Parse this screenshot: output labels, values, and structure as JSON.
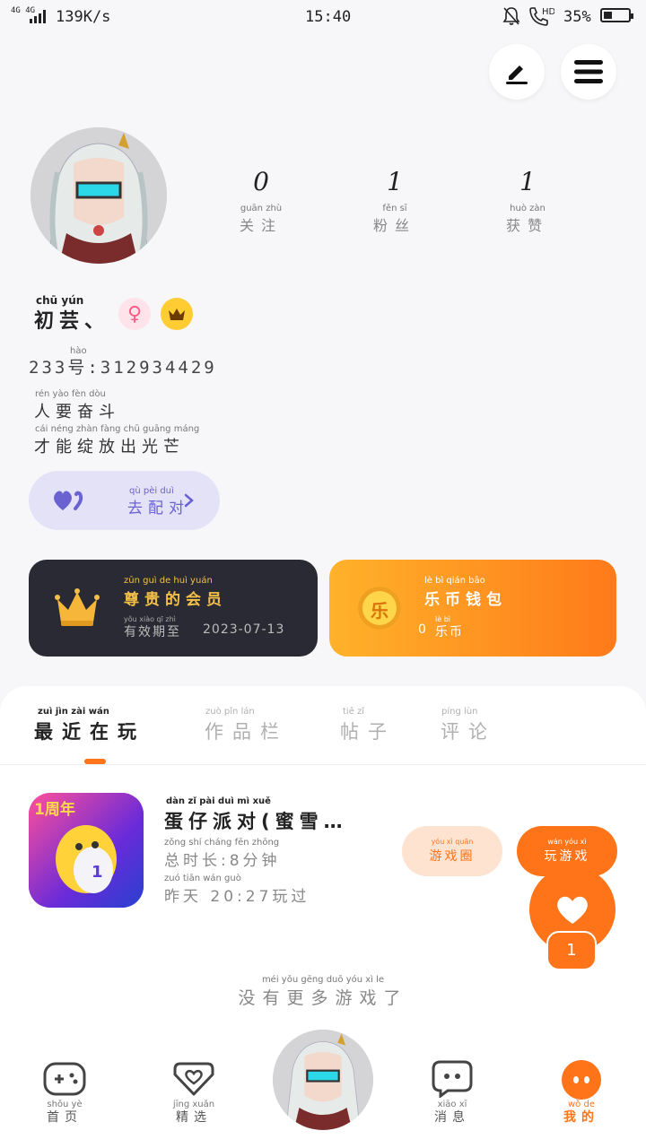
{
  "status_bar": {
    "network": "4G 4G",
    "speed": "139K/s",
    "time": "15:40",
    "hd": "HD",
    "battery": "35%",
    "battery_level": 0.35
  },
  "profile": {
    "stats": [
      {
        "value": "0",
        "pinyin": "guān  zhù",
        "label": "关注"
      },
      {
        "value": "1",
        "pinyin": "fěn   sī",
        "label": "粉丝"
      },
      {
        "value": "1",
        "pinyin": "huò  zàn",
        "label": "获赞"
      }
    ],
    "name_pinyin": "chū  yún",
    "name": "初芸、",
    "id_pinyin": "hào",
    "id": "233号:312934429",
    "bio_line1_pinyin": "rén  yào  fèn  dòu",
    "bio_line1": "人要奋斗",
    "bio_line2_pinyin": "cái néng zhàn fàng chū guāng máng",
    "bio_line2": "才能绽放出光芒",
    "pair_pinyin": "qù  pèi  duì",
    "pair_label": "去配对"
  },
  "cards": {
    "vip_pinyin": "zūn  guì  de  huì  yuán",
    "vip_title": "尊贵的会员",
    "vip_sub_pinyin": "yǒu xiào qī zhì",
    "vip_sub_label": "有效期至",
    "vip_date": "2023-07-13",
    "wallet_pinyin": "lè   bì  qián  bāo",
    "wallet_title": "乐币钱包",
    "wallet_icon": "乐",
    "wallet_sub_pinyin": "lè  bì",
    "wallet_amount": "0",
    "wallet_unit": "乐币"
  },
  "tabs": [
    {
      "pinyin": "zuì  jìn  zài  wán",
      "label": "最近在玩"
    },
    {
      "pinyin": "zuò  pǐn  lán",
      "label": "作品栏"
    },
    {
      "pinyin": "tiě  zǐ",
      "label": "帖子"
    },
    {
      "pinyin": "píng  lùn",
      "label": "评论"
    }
  ],
  "game": {
    "badge": "1周年",
    "title_pinyin": "dàn  zǐ  pài  duì  mì  xuě",
    "title": "蛋仔派对(蜜雪…",
    "duration_pinyin": "zǒng  shí  cháng      fēn zhōng",
    "duration": "总时长:8分钟",
    "last_played_pinyin": "zuó  tiān         wán guò",
    "last_played": "昨天 20:27玩过",
    "circle_pinyin": "yóu  xì  quān",
    "circle_label": "游戏圈",
    "play_pinyin": "wán  yóu  xì",
    "play_label": "玩游戏",
    "like_count": "1"
  },
  "no_more_pinyin": "méi  yǒu  gēng  duō  yóu  xì   le",
  "no_more": "没有更多游戏了",
  "nav": [
    {
      "pinyin": "shǒu  yè",
      "label": "首页",
      "icon": "gamepad-icon"
    },
    {
      "pinyin": "jīng  xuǎn",
      "label": "精选",
      "icon": "heart-bag-icon"
    },
    {
      "pinyin": "xiāo  xī",
      "label": "消息",
      "icon": "chat-icon"
    },
    {
      "pinyin": "wǒ   de",
      "label": "我的",
      "icon": "profile-face-icon"
    }
  ],
  "colors": {
    "accent": "#ff7418",
    "pair_purple": "#6a62d0",
    "vip_bg": "#2a2a35",
    "vip_gold": "#f5c04a"
  }
}
